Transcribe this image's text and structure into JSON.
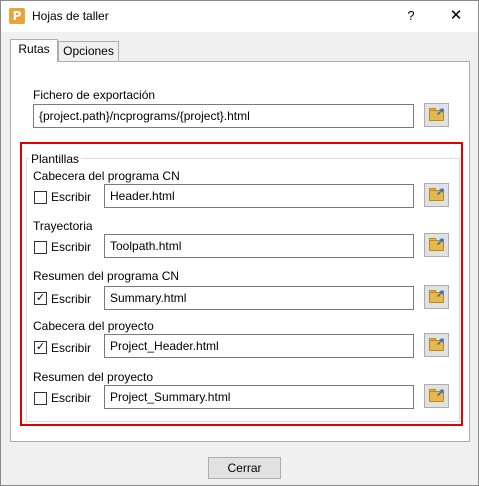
{
  "window": {
    "title": "Hojas de taller",
    "app_icon_letter": "P",
    "help_label": "?",
    "close_label": "✕"
  },
  "tabs": [
    {
      "label": "Rutas",
      "active": true
    },
    {
      "label": "Opciones",
      "active": false
    }
  ],
  "export": {
    "label": "Fichero de exportación",
    "value": "{project.path}/ncprograms/{project}.html"
  },
  "templates": {
    "group_label": "Plantillas",
    "checkbox_label": "Escribir",
    "items": [
      {
        "label": "Cabecera del programa CN",
        "checked": false,
        "value": "Header.html"
      },
      {
        "label": "Trayectoria",
        "checked": false,
        "value": "Toolpath.html"
      },
      {
        "label": "Resumen del programa CN",
        "checked": true,
        "value": "Summary.html"
      },
      {
        "label": "Cabecera del proyecto",
        "checked": true,
        "value": "Project_Header.html"
      },
      {
        "label": "Resumen del proyecto",
        "checked": false,
        "value": "Project_Summary.html"
      }
    ]
  },
  "footer": {
    "close_button": "Cerrar"
  },
  "colors": {
    "highlight_border": "#e00000",
    "folder": "#e8b84a",
    "arrow": "#2a6ecf"
  },
  "icons": {
    "browse": "open-folder-icon",
    "app": "powermill-app-icon"
  }
}
